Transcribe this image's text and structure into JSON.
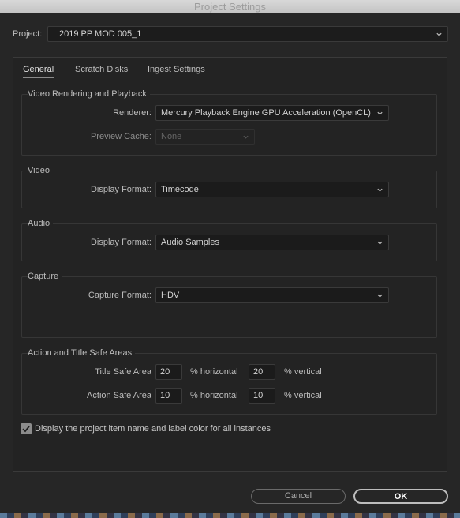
{
  "window": {
    "title": "Project Settings"
  },
  "project": {
    "label": "Project:",
    "value": "2019 PP MOD 005_1"
  },
  "tabs": [
    {
      "label": "General",
      "active": true
    },
    {
      "label": "Scratch Disks",
      "active": false
    },
    {
      "label": "Ingest Settings",
      "active": false
    }
  ],
  "video_rendering": {
    "title": "Video Rendering and Playback",
    "renderer_label": "Renderer:",
    "renderer_value": "Mercury Playback Engine GPU Acceleration (OpenCL)",
    "preview_cache_label": "Preview Cache:",
    "preview_cache_value": "None"
  },
  "video": {
    "title": "Video",
    "display_format_label": "Display Format:",
    "display_format_value": "Timecode"
  },
  "audio": {
    "title": "Audio",
    "display_format_label": "Display Format:",
    "display_format_value": "Audio Samples"
  },
  "capture": {
    "title": "Capture",
    "capture_format_label": "Capture Format:",
    "capture_format_value": "HDV"
  },
  "safe_areas": {
    "title": "Action and Title Safe Areas",
    "title_safe_label": "Title Safe Area",
    "title_safe_h": "20",
    "title_safe_v": "20",
    "action_safe_label": "Action Safe Area",
    "action_safe_h": "10",
    "action_safe_v": "10",
    "horizontal_unit": "% horizontal",
    "vertical_unit": "% vertical"
  },
  "display_label_option": {
    "checked": true,
    "label": "Display the project item name and label color for all instances"
  },
  "buttons": {
    "cancel": "Cancel",
    "ok": "OK"
  },
  "icons": {
    "dropdown": "chevron-down-icon",
    "checkbox": "checkmark-icon"
  }
}
